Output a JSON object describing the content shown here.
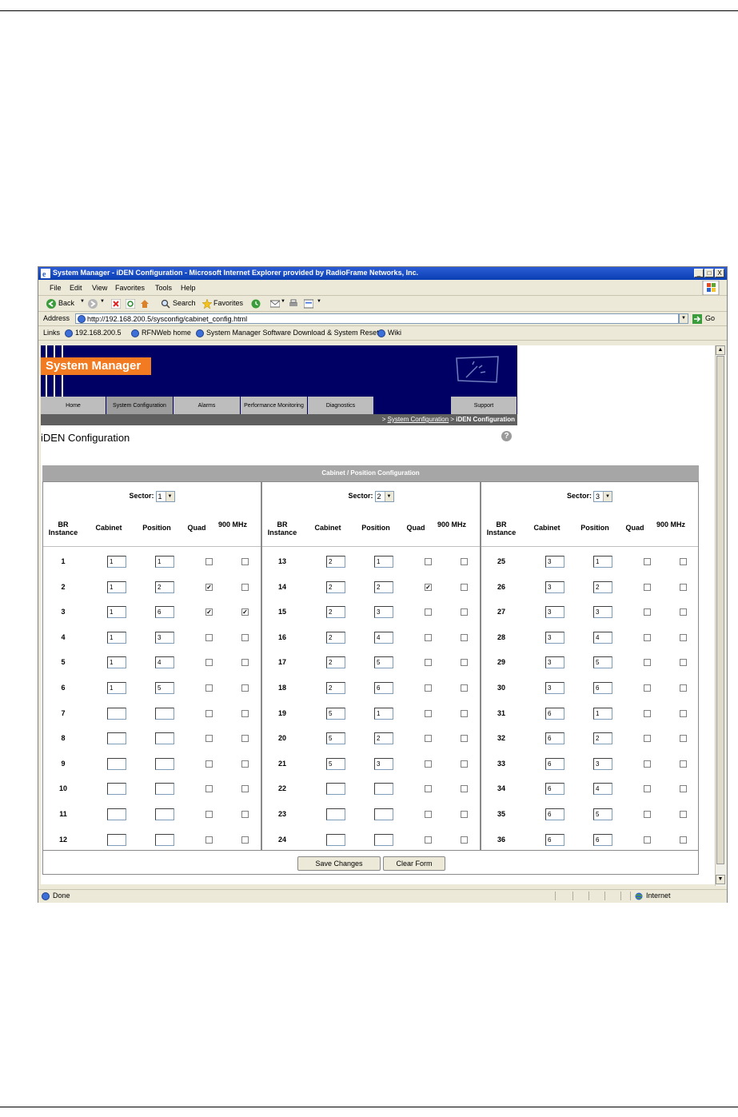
{
  "window": {
    "title": "System Manager - iDEN Configuration - Microsoft Internet Explorer provided by RadioFrame Networks, Inc.",
    "controls": [
      "_",
      "□",
      "X"
    ]
  },
  "menu": [
    "File",
    "Edit",
    "View",
    "Favorites",
    "Tools",
    "Help"
  ],
  "toolbar": {
    "back": "Back",
    "search": "Search",
    "favorites": "Favorites"
  },
  "address": {
    "label": "Address",
    "url": "http://192.168.200.5/sysconfig/cabinet_config.html",
    "go": "Go"
  },
  "links": {
    "label": "Links",
    "items": [
      "192.168.200.5",
      "RFNWeb home",
      "System Manager Software Download & System Reset",
      "Wiki"
    ]
  },
  "app": {
    "brand": "System Manager",
    "nav": [
      "Home",
      "System Configuration",
      "Alarms",
      "Performance Monitoring",
      "Diagnostics",
      "",
      "Support"
    ],
    "breadcrumb": {
      "sep1": ">",
      "link": "System Configuration",
      "sep2": ">",
      "current": "iDEN Configuration"
    },
    "page_title": "iDEN Configuration",
    "help": "?"
  },
  "table": {
    "title": "Cabinet / Position Configuration",
    "sector_label": "Sector:",
    "columns": [
      "BR Instance",
      "Cabinet",
      "Position",
      "Quad",
      "900 MHz"
    ],
    "sectors": [
      {
        "value": "1",
        "rows": [
          {
            "br": "1",
            "cab": "1",
            "pos": "1",
            "quad": false,
            "mhz": false
          },
          {
            "br": "2",
            "cab": "1",
            "pos": "2",
            "quad": true,
            "mhz": false
          },
          {
            "br": "3",
            "cab": "1",
            "pos": "6",
            "quad": true,
            "mhz": true
          },
          {
            "br": "4",
            "cab": "1",
            "pos": "3",
            "quad": false,
            "mhz": false
          },
          {
            "br": "5",
            "cab": "1",
            "pos": "4",
            "quad": false,
            "mhz": false
          },
          {
            "br": "6",
            "cab": "1",
            "pos": "5",
            "quad": false,
            "mhz": false
          },
          {
            "br": "7",
            "cab": "",
            "pos": "",
            "quad": false,
            "mhz": false
          },
          {
            "br": "8",
            "cab": "",
            "pos": "",
            "quad": false,
            "mhz": false
          },
          {
            "br": "9",
            "cab": "",
            "pos": "",
            "quad": false,
            "mhz": false
          },
          {
            "br": "10",
            "cab": "",
            "pos": "",
            "quad": false,
            "mhz": false
          },
          {
            "br": "11",
            "cab": "",
            "pos": "",
            "quad": false,
            "mhz": false
          },
          {
            "br": "12",
            "cab": "",
            "pos": "",
            "quad": false,
            "mhz": false
          }
        ]
      },
      {
        "value": "2",
        "rows": [
          {
            "br": "13",
            "cab": "2",
            "pos": "1",
            "quad": false,
            "mhz": false
          },
          {
            "br": "14",
            "cab": "2",
            "pos": "2",
            "quad": true,
            "mhz": false
          },
          {
            "br": "15",
            "cab": "2",
            "pos": "3",
            "quad": false,
            "mhz": false
          },
          {
            "br": "16",
            "cab": "2",
            "pos": "4",
            "quad": false,
            "mhz": false
          },
          {
            "br": "17",
            "cab": "2",
            "pos": "5",
            "quad": false,
            "mhz": false
          },
          {
            "br": "18",
            "cab": "2",
            "pos": "6",
            "quad": false,
            "mhz": false
          },
          {
            "br": "19",
            "cab": "5",
            "pos": "1",
            "quad": false,
            "mhz": false
          },
          {
            "br": "20",
            "cab": "5",
            "pos": "2",
            "quad": false,
            "mhz": false
          },
          {
            "br": "21",
            "cab": "5",
            "pos": "3",
            "quad": false,
            "mhz": false
          },
          {
            "br": "22",
            "cab": "",
            "pos": "",
            "quad": false,
            "mhz": false
          },
          {
            "br": "23",
            "cab": "",
            "pos": "",
            "quad": false,
            "mhz": false
          },
          {
            "br": "24",
            "cab": "",
            "pos": "",
            "quad": false,
            "mhz": false
          }
        ]
      },
      {
        "value": "3",
        "rows": [
          {
            "br": "25",
            "cab": "3",
            "pos": "1",
            "quad": false,
            "mhz": false
          },
          {
            "br": "26",
            "cab": "3",
            "pos": "2",
            "quad": false,
            "mhz": false
          },
          {
            "br": "27",
            "cab": "3",
            "pos": "3",
            "quad": false,
            "mhz": false
          },
          {
            "br": "28",
            "cab": "3",
            "pos": "4",
            "quad": false,
            "mhz": false
          },
          {
            "br": "29",
            "cab": "3",
            "pos": "5",
            "quad": false,
            "mhz": false
          },
          {
            "br": "30",
            "cab": "3",
            "pos": "6",
            "quad": false,
            "mhz": false
          },
          {
            "br": "31",
            "cab": "6",
            "pos": "1",
            "quad": false,
            "mhz": false
          },
          {
            "br": "32",
            "cab": "6",
            "pos": "2",
            "quad": false,
            "mhz": false
          },
          {
            "br": "33",
            "cab": "6",
            "pos": "3",
            "quad": false,
            "mhz": false
          },
          {
            "br": "34",
            "cab": "6",
            "pos": "4",
            "quad": false,
            "mhz": false
          },
          {
            "br": "35",
            "cab": "6",
            "pos": "5",
            "quad": false,
            "mhz": false
          },
          {
            "br": "36",
            "cab": "6",
            "pos": "6",
            "quad": false,
            "mhz": false
          }
        ]
      }
    ],
    "buttons": {
      "save": "Save Changes",
      "clear": "Clear Form"
    }
  },
  "status": {
    "left": "Done",
    "zone": "Internet"
  },
  "colors": {
    "banner": "#000064",
    "brand": "#f27a21",
    "titlebar": "#0a3fb3",
    "table_header": "#a6a6a6"
  }
}
